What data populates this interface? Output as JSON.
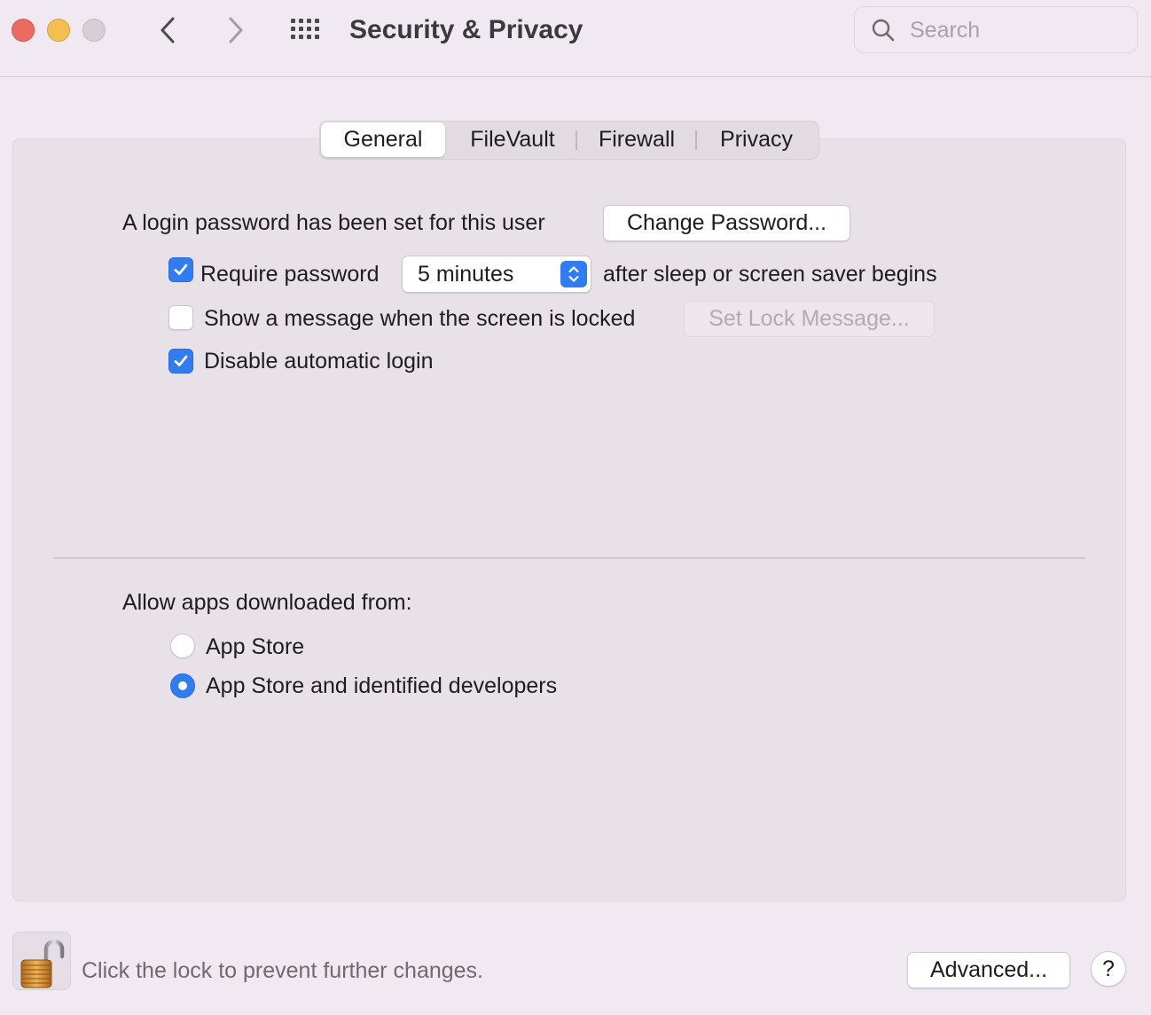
{
  "window": {
    "title": "Security & Privacy",
    "search_placeholder": "Search"
  },
  "icons": {
    "back": "chevron-left-icon",
    "forward": "chevron-right-icon",
    "show_all": "grid-icon",
    "search": "search-icon",
    "lock": "lock-icon"
  },
  "colors": {
    "accent": "#2f7cf6",
    "close": "#ed6a5e",
    "minimize": "#f5bf4f",
    "zoom_disabled": "#d6d0d6"
  },
  "tabs": [
    {
      "label": "General",
      "active": true
    },
    {
      "label": "FileVault",
      "active": false
    },
    {
      "label": "Firewall",
      "active": false
    },
    {
      "label": "Privacy",
      "active": false
    }
  ],
  "general": {
    "login_password_text": "A login password has been set for this user",
    "change_password_button": "Change Password...",
    "require_password": {
      "label": "Require password",
      "checked": true,
      "delay_value": "5 minutes",
      "suffix": "after sleep or screen saver begins"
    },
    "show_message": {
      "label": "Show a message when the screen is locked",
      "checked": false,
      "button": "Set Lock Message..."
    },
    "disable_auto_login": {
      "label": "Disable automatic login",
      "checked": true
    }
  },
  "allow_apps": {
    "heading": "Allow apps downloaded from:",
    "options": [
      {
        "label": "App Store",
        "selected": false
      },
      {
        "label": "App Store and identified developers",
        "selected": true
      }
    ]
  },
  "footer": {
    "lock_text": "Click the lock to prevent further changes.",
    "advanced_button": "Advanced...",
    "help_button": "?"
  }
}
